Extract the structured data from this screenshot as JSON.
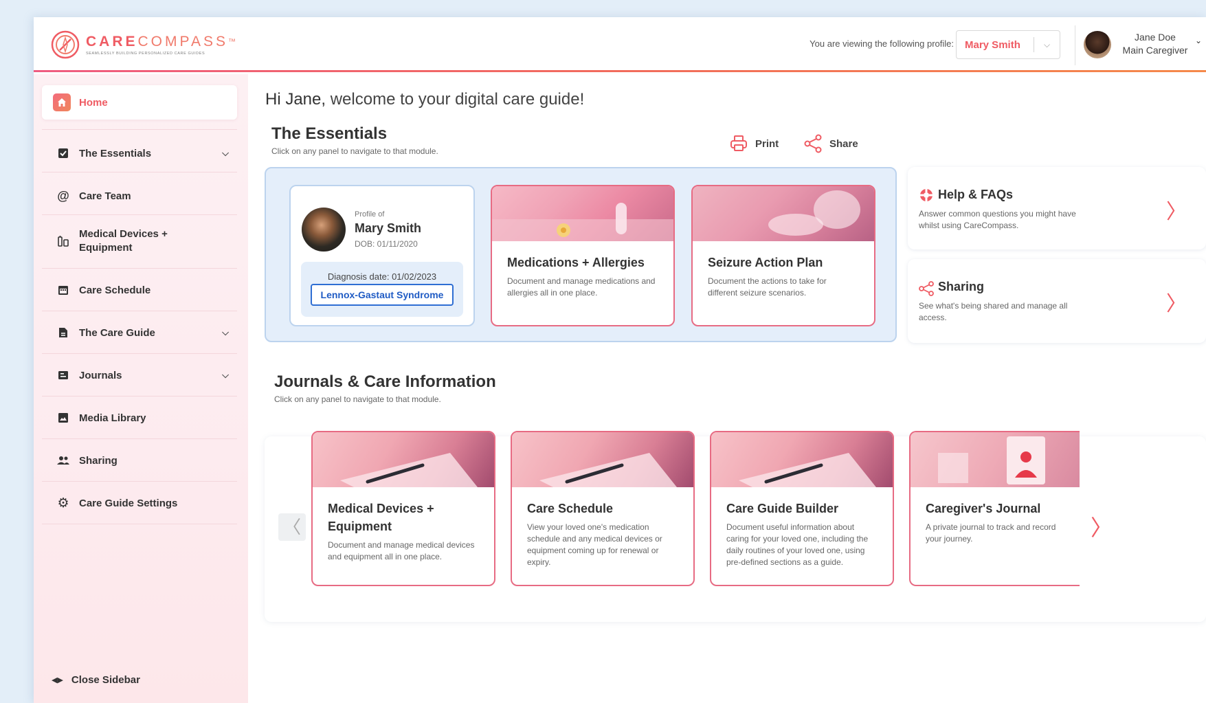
{
  "header": {
    "brand_bold": "CARE",
    "brand_light": "COMPASS",
    "brand_tm": "™",
    "tagline": "SEAMLESSLY BUILDING PERSONALIZED CARE GUIDES",
    "viewing_label": "You are viewing the following profile:",
    "selected_profile": "Mary Smith",
    "user_name": "Jane Doe",
    "user_role": "Main Caregiver"
  },
  "sidebar": {
    "items": [
      {
        "label": "Home",
        "icon": "home-icon"
      },
      {
        "label": "The Essentials",
        "icon": "checkbox-icon"
      },
      {
        "label": "Care Team",
        "icon": "at-icon"
      },
      {
        "label": "Medical Devices +",
        "label2": "Equipment",
        "icon": "devices-icon"
      },
      {
        "label": "Care Schedule",
        "icon": "calendar-icon"
      },
      {
        "label": "The Care Guide",
        "icon": "document-icon"
      },
      {
        "label": "Journals",
        "icon": "journal-icon"
      },
      {
        "label": "Media Library",
        "icon": "image-icon"
      },
      {
        "label": "Sharing",
        "icon": "people-icon"
      },
      {
        "label": "Care Guide Settings",
        "icon": "gear-icon"
      }
    ],
    "close_label": "Close Sidebar"
  },
  "main": {
    "greeting_hi": "Hi Jane,",
    "greeting_rest": "welcome to your digital care guide!",
    "essentials": {
      "title": "The Essentials",
      "subtitle": "Click on any panel to navigate to that module.",
      "print_label": "Print",
      "share_label": "Share",
      "profile": {
        "profile_of": "Profile of",
        "name": "Mary Smith",
        "dob": "DOB: 01/11/2020",
        "diagnosis_date": "Diagnosis date: 01/02/2023",
        "diagnosis": "Lennox-Gastaut Syndrome"
      },
      "cards": [
        {
          "title": "Medications + Allergies",
          "desc": "Document and manage medications and allergies all in one place."
        },
        {
          "title": "Seizure Action Plan",
          "desc": "Document the actions to take for different seizure scenarios."
        }
      ]
    },
    "help": {
      "title": "Help & FAQs",
      "desc": "Answer common questions you might have whilst using CareCompass.",
      "arrow": "〉"
    },
    "sharing": {
      "title": "Sharing",
      "desc": "See what's being shared and manage all access.",
      "arrow": "〉"
    },
    "journals": {
      "title": "Journals & Care Information",
      "subtitle": "Click on any panel to navigate to that module.",
      "prev": "〈",
      "next": "〉",
      "cards": [
        {
          "title": "Medical Devices +",
          "title2": "Equipment",
          "desc": "Document and manage medical devices and equipment all in one place."
        },
        {
          "title": "Care Schedule",
          "desc": "View your loved one's medication schedule and any medical devices or equipment coming up for renewal or expiry."
        },
        {
          "title": "Care Guide Builder",
          "desc": "Document useful information about caring for your loved one, including the daily routines of your loved one, using pre-defined sections as a guide."
        },
        {
          "title": "Caregiver's Journal",
          "desc": "A private journal to track and record your journey."
        }
      ]
    }
  },
  "colors": {
    "accent": "#ef5b63",
    "accent2": "#f5894a",
    "panel_blue": "#e4eefa",
    "link_blue": "#1f5bc4"
  }
}
